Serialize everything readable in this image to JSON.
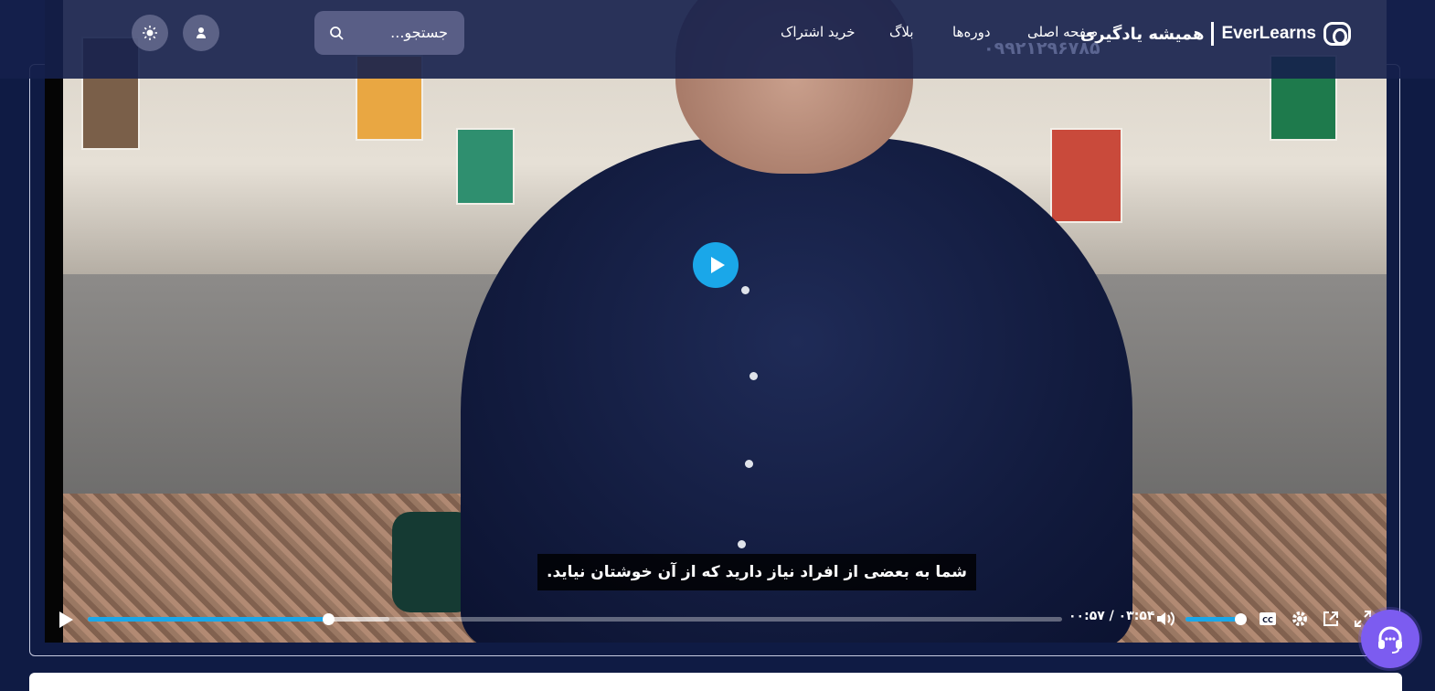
{
  "header": {
    "logo_fa": "همیشه یادگیری",
    "logo_en": "EverLearns",
    "phone": "۰۹۹۲۱۲۹۶۷۸۵",
    "nav": [
      {
        "label": "صفحه اصلی"
      },
      {
        "label": "دوره‌ها"
      },
      {
        "label": "بلاگ"
      },
      {
        "label": "خرید اشتراک"
      }
    ],
    "search_placeholder": "جستجو..."
  },
  "video": {
    "subtitle": "شما به بعضی از افراد نیاز دارید که از آن خوشتان نیاید.",
    "time_text": "۰۰:۵۷ / ۰۳:۵۴",
    "progress_fraction": 0.247,
    "buffered_fraction": 0.31,
    "volume_fraction": 1.0
  },
  "colors": {
    "accent": "#1aa7e9",
    "page_bg": "#0f1b44",
    "support": "#7c5cf0"
  },
  "icons": [
    "logo-icon",
    "search-icon",
    "user-icon",
    "sun-icon",
    "play-icon",
    "volume-icon",
    "captions-icon",
    "settings-icon",
    "pip-icon",
    "fullscreen-icon",
    "headset-icon"
  ]
}
